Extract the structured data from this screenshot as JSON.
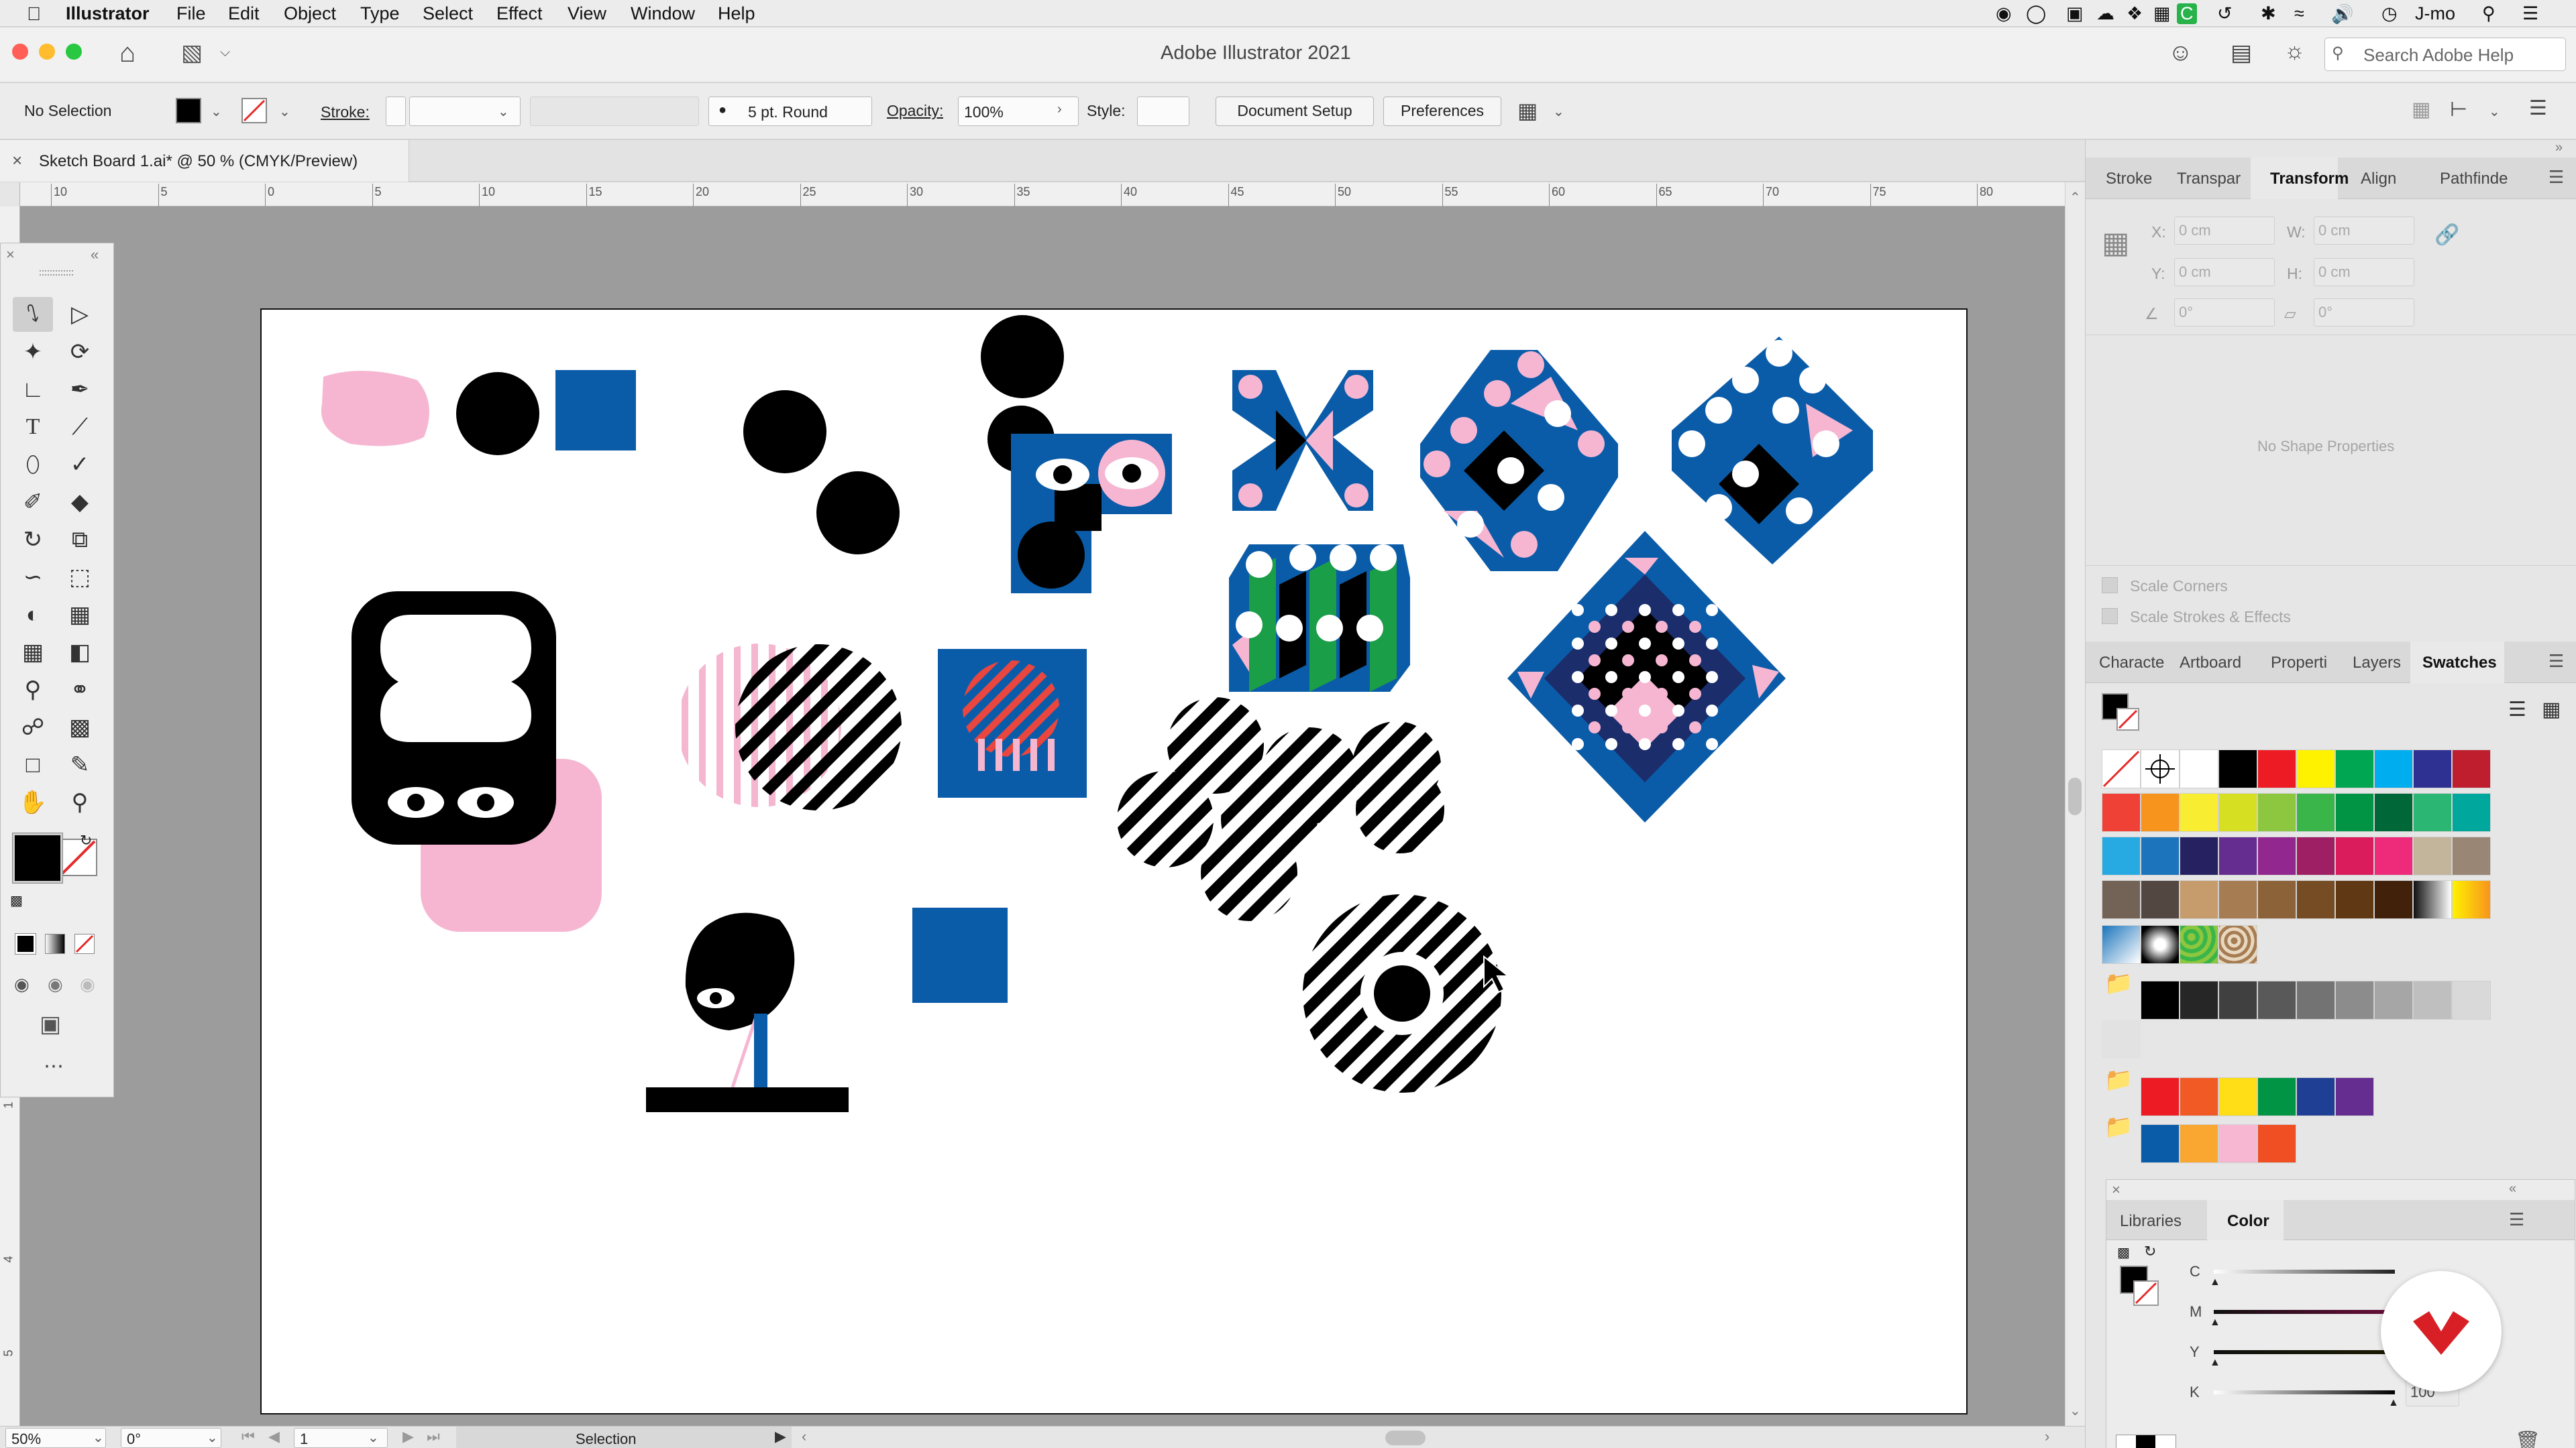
{
  "menubar": {
    "app": "Illustrator",
    "items": [
      "File",
      "Edit",
      "Object",
      "Type",
      "Select",
      "Effect",
      "View",
      "Window",
      "Help"
    ],
    "user": "J-mo"
  },
  "window": {
    "title": "Adobe Illustrator 2021",
    "search_placeholder": "Search Adobe Help"
  },
  "control": {
    "selection": "No Selection",
    "stroke_label": "Stroke:",
    "brush": "5 pt. Round",
    "opacity_label": "Opacity:",
    "opacity": "100%",
    "style_label": "Style:",
    "doc_setup": "Document Setup",
    "preferences": "Preferences"
  },
  "document": {
    "tab": "Sketch Board 1.ai* @ 50 % (CMYK/Preview)"
  },
  "ruler": {
    "ticks": [
      "10",
      "5",
      "0",
      "5",
      "10",
      "15",
      "20",
      "25",
      "30",
      "35",
      "40",
      "45",
      "50",
      "55",
      "60",
      "65",
      "70",
      "75",
      "80"
    ]
  },
  "transform_panel": {
    "tabs": [
      "Stroke",
      "Transpar",
      "Transform",
      "Align",
      "Pathfinde"
    ],
    "active": "Transform",
    "x_label": "X:",
    "y_label": "Y:",
    "w_label": "W:",
    "h_label": "H:",
    "x": "0 cm",
    "y": "0 cm",
    "w": "0 cm",
    "h": "0 cm",
    "angle": "0°",
    "shear": "0°",
    "empty": "No Shape Properties",
    "scale_corners": "Scale Corners",
    "scale_strokes": "Scale Strokes & Effects"
  },
  "swatches_panel": {
    "tabs": [
      "Characte",
      "Artboard",
      "Properti",
      "Layers",
      "Swatches"
    ],
    "active": "Swatches",
    "rows": [
      [
        "#ffffff",
        "#ffffff",
        "#ffffff",
        "#000000",
        "#ed1c24",
        "#fff200",
        "#00a651",
        "#00aeef",
        "#2e3192",
        "#be1e2d"
      ],
      [
        "#ef4136",
        "#f7941d",
        "#f9ed32",
        "#d7df23",
        "#8dc63f",
        "#39b54a",
        "#009444",
        "#006838",
        "#2bb673",
        "#00a79d"
      ],
      [
        "#27aae1",
        "#1c75bc",
        "#262262",
        "#662d91",
        "#92278f",
        "#9e1f63",
        "#da1c5c",
        "#ee2a7b",
        "#c2b59b",
        "#998675"
      ],
      [
        "#736357",
        "#534741",
        "#c69c6d",
        "#a67c52",
        "#8c6239",
        "#754c24",
        "#603813",
        "#42210b",
        "#111111",
        "#f7941d"
      ]
    ],
    "grays": [
      "#000000",
      "#262626",
      "#404040",
      "#595959",
      "#737373",
      "#8c8c8c",
      "#a6a6a6",
      "#bfbfbf",
      "#d9d9d9"
    ],
    "group1": [
      "#ed1c24",
      "#f15a24",
      "#ffde17",
      "#009444",
      "#1e3f94",
      "#662d91"
    ],
    "group2": [
      "#0b5ca8",
      "#faa732",
      "#f7b7d2",
      "#f04e23"
    ]
  },
  "color_panel": {
    "tabs": [
      "Libraries",
      "Color"
    ],
    "active": "Color",
    "channels": [
      "C",
      "M",
      "Y",
      "K"
    ],
    "k_value": "100"
  },
  "status": {
    "zoom": "50%",
    "rotation": "0°",
    "artboard": "1",
    "tool": "Selection"
  }
}
